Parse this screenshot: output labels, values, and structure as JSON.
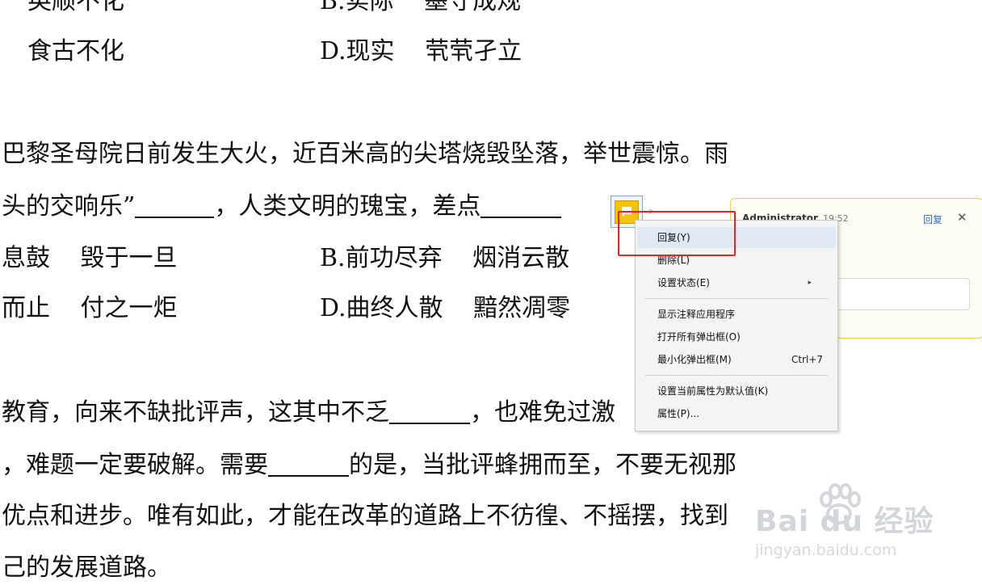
{
  "document": {
    "lines": [
      {
        "a": "英顺不化",
        "b": "B.实际",
        "c": "墨守成规"
      },
      {
        "a": "食古不化",
        "b": "D.现实",
        "c": "茕茕孑立"
      },
      {
        "text1": "巴黎圣母院日前发生大火，近百米高的尖塔烧毁坠落，举世震惊。雨"
      },
      {
        "pre": "头的交响乐”",
        "mid": "，人类文明的瑰宝，差点"
      },
      {
        "a": "息鼓",
        "a2": "毁于一旦",
        "b": "B.前功尽弃",
        "c": "烟消云散"
      },
      {
        "a": "而止",
        "a2": "付之一炬",
        "b": "D.曲终人散",
        "c": "黯然凋零"
      },
      {
        "pre": "教育，向来不缺批评声，这其中不乏",
        "mid": "，也难免过激"
      },
      {
        "pre": "，难题一定要破解。需要",
        "mid": "的是，当批评蜂拥而至，不要无视那"
      },
      {
        "text1": "优点和进步。唯有如此，才能在改革的道路上不彷徨、不摇摆，找到"
      },
      {
        "text1": "己的发展道路。"
      }
    ]
  },
  "comment_popup": {
    "author": "Administrator",
    "time": "19:52",
    "reply_label": "回复",
    "close_icon": "close-icon"
  },
  "context_menu": {
    "items": [
      {
        "label": "回复(Y)",
        "shortcut": ""
      },
      {
        "label": "删除(L)",
        "shortcut": ""
      },
      {
        "label": "设置状态(E)",
        "shortcut": "",
        "submenu": true
      },
      {
        "label": "显示注释应用程序",
        "shortcut": ""
      },
      {
        "label": "打开所有弹出框(O)",
        "shortcut": ""
      },
      {
        "label": "最小化弹出框(M)",
        "shortcut": "Ctrl+7"
      },
      {
        "label": "设置当前属性为默认值(K)",
        "shortcut": ""
      },
      {
        "label": "属性(P)...",
        "shortcut": ""
      }
    ]
  },
  "watermark": {
    "logo": "Bai du 经验",
    "url": "jingyan.baidu.com"
  },
  "colors": {
    "highlight_border": "#e0252b",
    "note_icon": "#f2c40f",
    "link": "#2c6fc9"
  }
}
